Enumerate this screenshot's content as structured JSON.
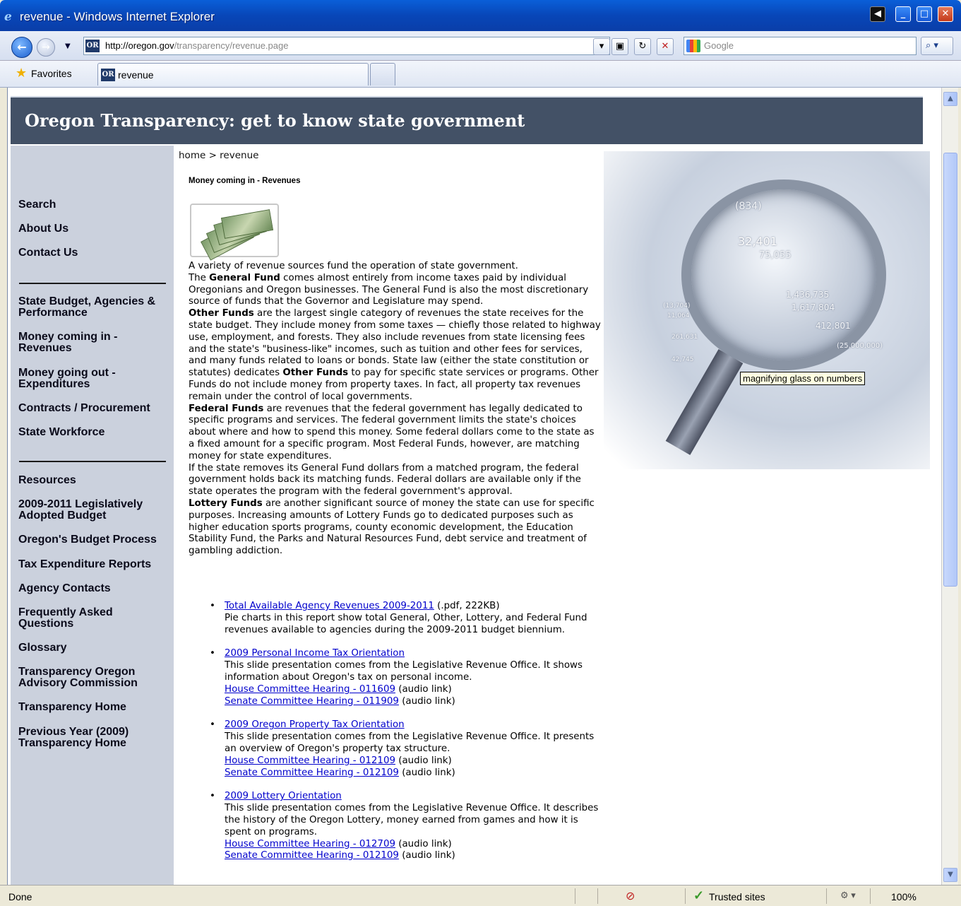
{
  "window": {
    "title": "revenue - Windows Internet Explorer",
    "minimize": "_",
    "maximize": "□",
    "close": "✕",
    "side": "◀"
  },
  "navbar": {
    "back": "←",
    "forward": "→",
    "address_domain": "http://oregon.gov",
    "address_path": "/transparency/revenue.page",
    "site_badge": "OR",
    "search_placeholder": "Google",
    "search_button": "⌕ ▾"
  },
  "favbar": {
    "favorites_label": "Favorites",
    "tab_title": "revenue"
  },
  "page": {
    "banner_title": "Oregon Transparency: get to know state government",
    "breadcrumb": "home > revenue",
    "heading": "Money coming in - Revenues",
    "tooltip": "magnifying glass on numbers"
  },
  "sidebar": {
    "items": [
      "Search",
      "About Us",
      "Contact Us",
      "State Budget, Agencies & Performance",
      "Money coming in - Revenues",
      "Money going out - Expenditures",
      "Contracts / Procurement",
      "State Workforce",
      "Resources",
      "2009-2011 Legislatively Adopted Budget",
      "Oregon's Budget Process",
      "Tax Expenditure Reports",
      "Agency Contacts",
      "Frequently Asked Questions",
      "Glossary",
      "Transparency Oregon Advisory Commission",
      "Transparency Home",
      "Previous Year (2009) Transparency Home"
    ]
  },
  "body": {
    "p1": "A variety of revenue sources fund the operation of state government.",
    "gf_term": "General Fund",
    "p2a": "The ",
    "p2b": " comes almost entirely from income taxes paid by individual Oregonians and Oregon businesses. The General Fund is also the most discretionary source of funds that the Governor and Legislature may spend.",
    "of_term": "Other Funds",
    "p3a": " are the largest single category of revenues the state receives for the state budget. They include money from some taxes — chiefly those related to highway use, employment, and forests. They also include revenues from state licensing fees and the state's \"business-like\" incomes, such as tuition and other fees for services, and many funds related to loans or bonds. State law (either the state constitution or statutes) dedicates ",
    "p3b": " to pay for specific state services or programs. Other Funds do not include money from property taxes. In fact, all property tax revenues remain under the control of local governments.",
    "ff_term": "Federal Funds",
    "p4": " are revenues that the federal government has legally dedicated to specific programs and services. The federal government limits the state's choices about where and how to spend this money. Some federal dollars come to the state as a fixed amount for a specific program. Most Federal Funds, however, are matching money for state expenditures.",
    "p5": "If the state removes its General Fund dollars from a matched program, the federal government holds back its matching funds. Federal dollars are available only if the state operates the program with the federal government's approval.",
    "lf_term": "Lottery Funds",
    "p6": " are another significant source of money the state can use for specific purposes. Increasing amounts of Lottery Funds go to dedicated purposes such as higher education sports programs, county economic development, the Education Stability Fund, the Parks and Natural Resources Fund, debt service and treatment of gambling addiction."
  },
  "resources": [
    {
      "link": "Total Available Agency Revenues 2009-2011",
      "suffix": " (.pdf, 222KB)",
      "desc": "Pie charts in this report show total General, Other, Lottery, and Federal Fund revenues available to agencies during the 2009-2011 budget biennium.",
      "house": "",
      "senate": ""
    },
    {
      "link": "2009 Personal Income Tax Orientation",
      "suffix": "",
      "desc": "This slide presentation comes from the Legislative Revenue Office. It shows information about Oregon's tax on personal income.",
      "house": "House Committee Hearing - 011609",
      "senate": "Senate Committee Hearing - 011909"
    },
    {
      "link": "2009 Oregon Property Tax Orientation",
      "suffix": "",
      "desc": "This slide presentation comes from the Legislative Revenue Office. It presents an overview of Oregon's property tax structure.",
      "house": "House Committee Hearing - 012109",
      "senate": "Senate Committee Hearing - 012109"
    },
    {
      "link": "2009 Lottery Orientation",
      "suffix": "",
      "desc": "This slide presentation comes from the Legislative Revenue Office. It describes the history of the Oregon Lottery, money earned from games and how it is spent on programs.",
      "house": "House Committee Hearing - 012709",
      "senate": "Senate Committee Hearing - 012109"
    }
  ],
  "audio_label": " (audio link)",
  "hero_numbers": [
    "32,401",
    "75,055",
    "1,436,735",
    "1,617,804",
    "412,801",
    "(25,000,000)",
    "(13,704)",
    "11,064",
    "261,631",
    "42,745",
    "(834)"
  ],
  "status": {
    "left": "Done",
    "zone": "Trusted sites",
    "zoom": "100%"
  }
}
